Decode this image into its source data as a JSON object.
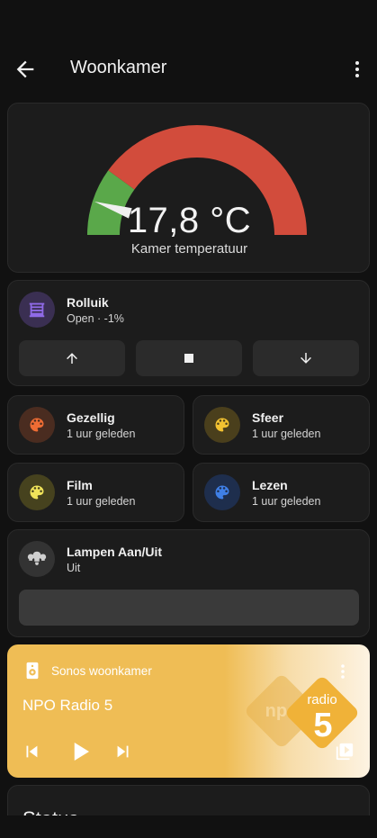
{
  "header": {
    "title": "Woonkamer",
    "back_icon": "arrow-left-icon",
    "menu_icon": "dots-vertical-icon"
  },
  "gauge": {
    "value_text": "17,8 °C",
    "name": "Kamer temperatuur",
    "level_fraction": 0.1,
    "colors": {
      "green": "#5aa84a",
      "red": "#d24c3c",
      "needle": "#f0f0f0"
    }
  },
  "cover": {
    "name": "Rolluik",
    "state": "Open · -1%",
    "icon": "window-shutter-icon",
    "icon_color": "#7e5ad8",
    "buttons": [
      "arrow-up-icon",
      "stop-icon",
      "arrow-down-icon"
    ]
  },
  "scenes": [
    {
      "name": "Gezellig",
      "state": "1 uur geleden",
      "icon": "palette-icon",
      "color": "#ee6c34"
    },
    {
      "name": "Sfeer",
      "state": "1 uur geleden",
      "icon": "palette-icon",
      "color": "#f2c231"
    },
    {
      "name": "Film",
      "state": "1 uur geleden",
      "icon": "palette-icon",
      "color": "#f0e35a"
    },
    {
      "name": "Lezen",
      "state": "1 uur geleden",
      "icon": "palette-icon",
      "color": "#3f7fe6"
    }
  ],
  "lamps": {
    "name": "Lampen Aan/Uit",
    "state": "Uit",
    "icon": "lightbulb-group-icon"
  },
  "media": {
    "player_name": "Sonos woonkamer",
    "title": "NPO Radio 5",
    "icon": "speaker-icon",
    "artwork": "npo-radio-5-logo",
    "logo_text_top": "npo",
    "logo_text_bottom": "radio",
    "logo_number": "5",
    "controls": [
      "skip-previous-icon",
      "play-icon",
      "skip-next-icon"
    ],
    "accent": "#efbd55"
  },
  "status": {
    "title": "Status"
  }
}
